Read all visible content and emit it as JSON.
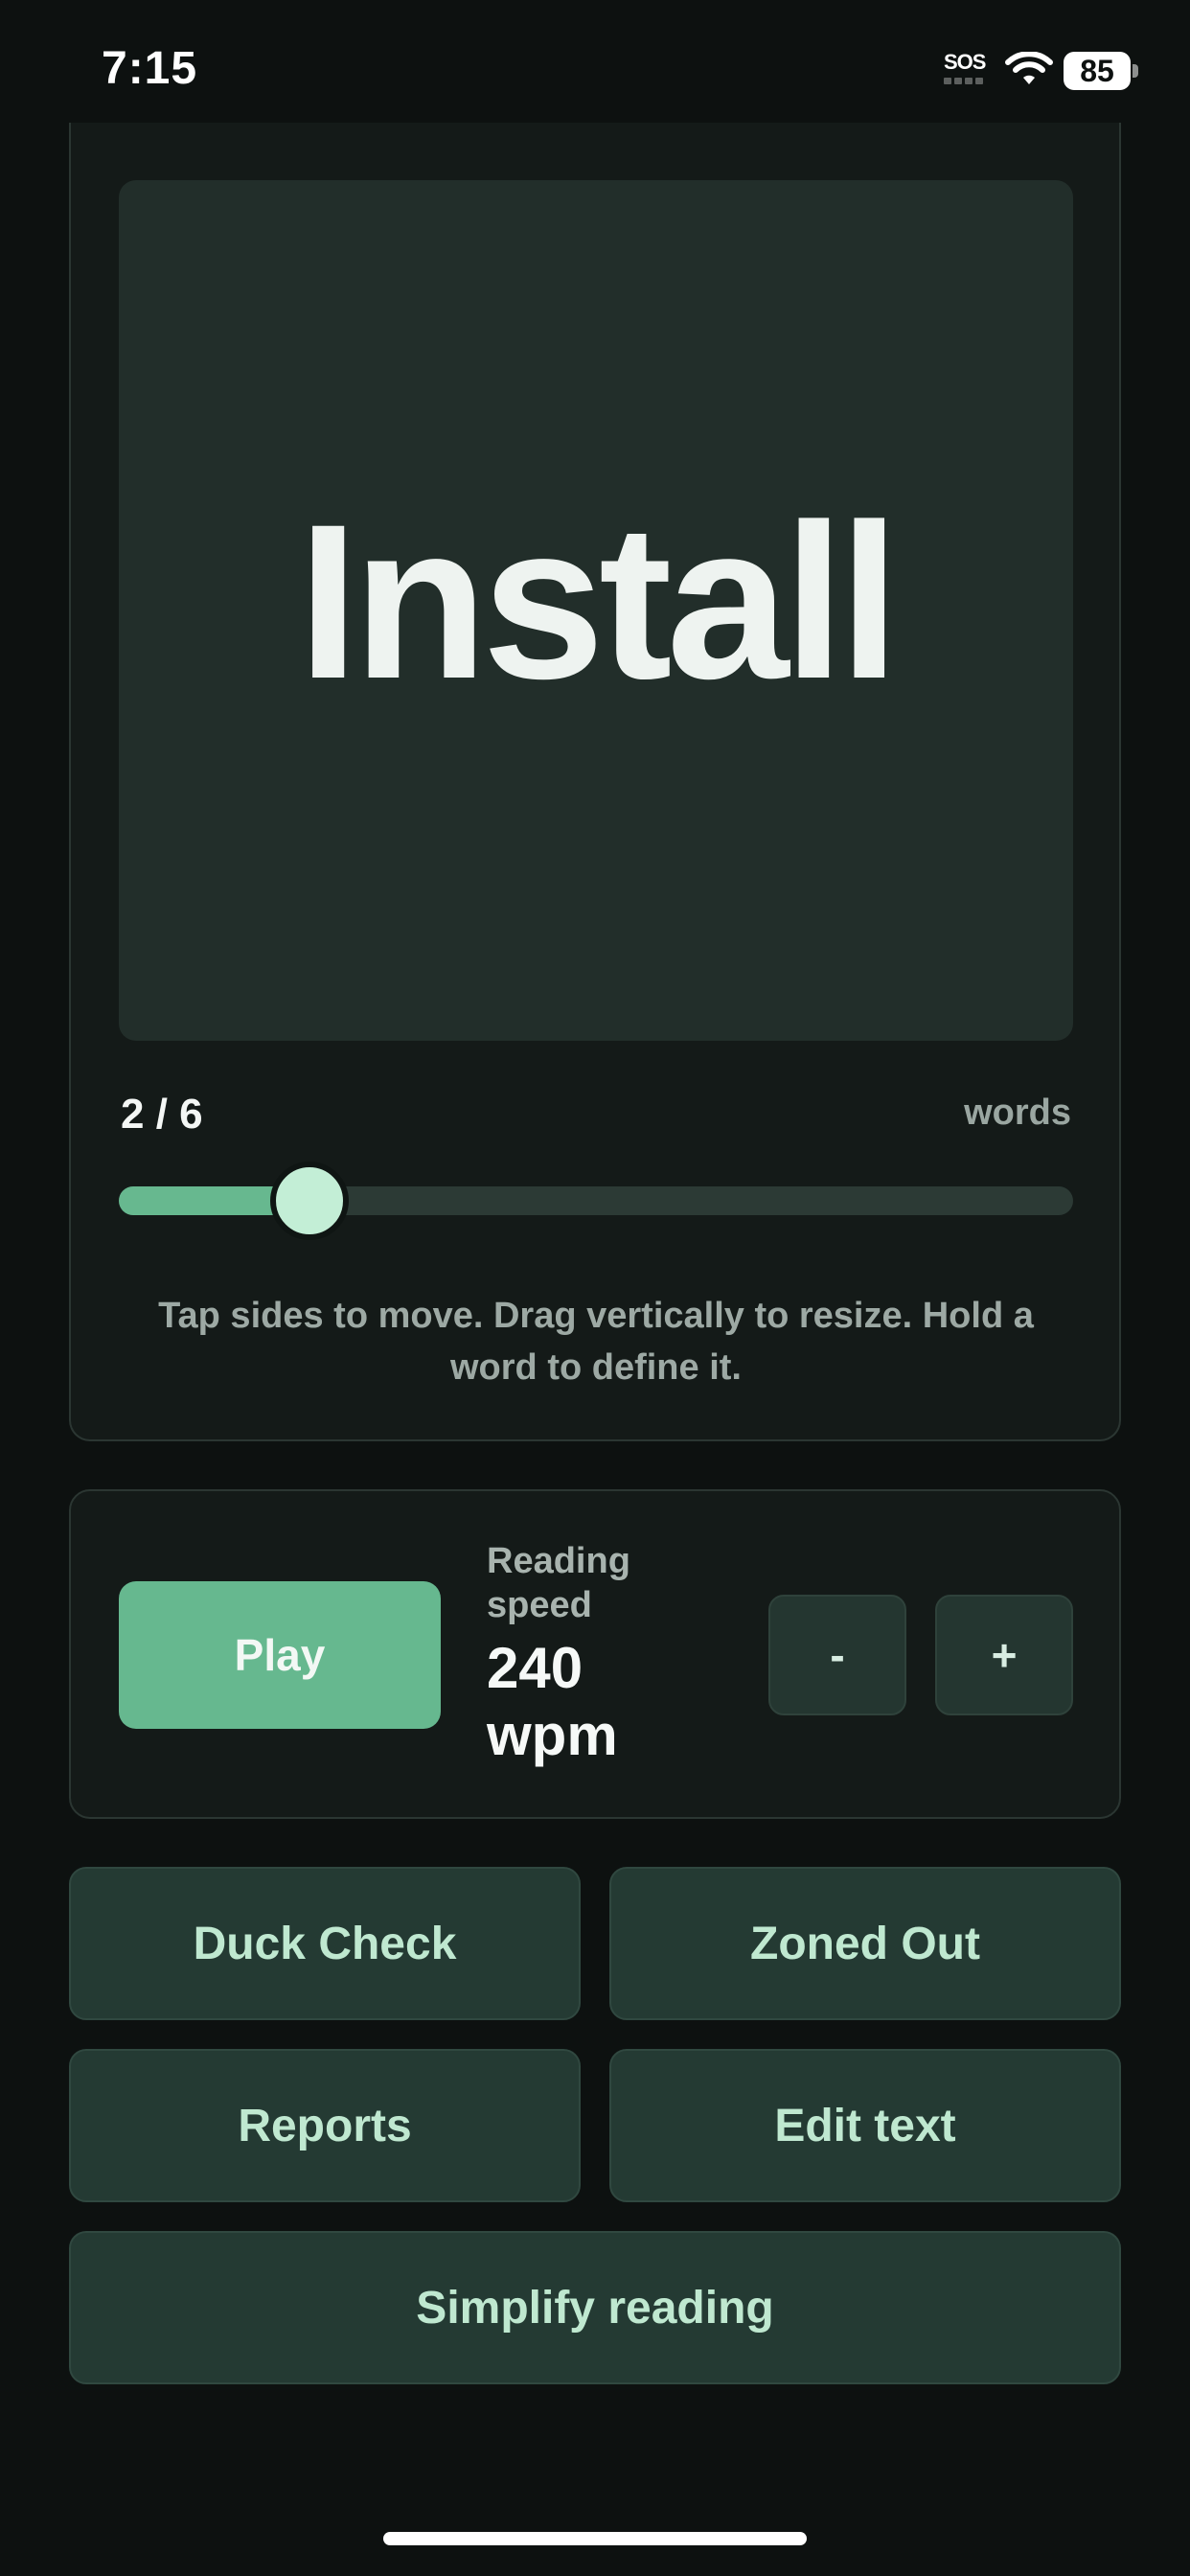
{
  "status_bar": {
    "time": "7:15",
    "sos": "SOS",
    "battery": "85",
    "icons": [
      "sos-signal-icon",
      "wifi-icon",
      "battery-icon"
    ]
  },
  "reader": {
    "current_word": "Install",
    "progress": {
      "count": "2 / 6",
      "unit": "words",
      "current": 2,
      "total": 6
    },
    "hint": "Tap sides to move. Drag vertically to resize. Hold a word to define it."
  },
  "speed": {
    "play_label": "Play",
    "label": "Reading speed",
    "value": "240 wpm",
    "decrease_label": "-",
    "increase_label": "+"
  },
  "actions": {
    "duck_check": "Duck Check",
    "zoned_out": "Zoned Out",
    "reports": "Reports",
    "edit_text": "Edit text",
    "simplify_reading": "Simplify reading"
  },
  "colors": {
    "background": "#0d1110",
    "card": "#141a18",
    "word_panel": "#222e2a",
    "accent": "#66b88f",
    "thumb": "#c3eed6",
    "action_bg": "#243a33",
    "action_text": "#bfe8d0"
  }
}
